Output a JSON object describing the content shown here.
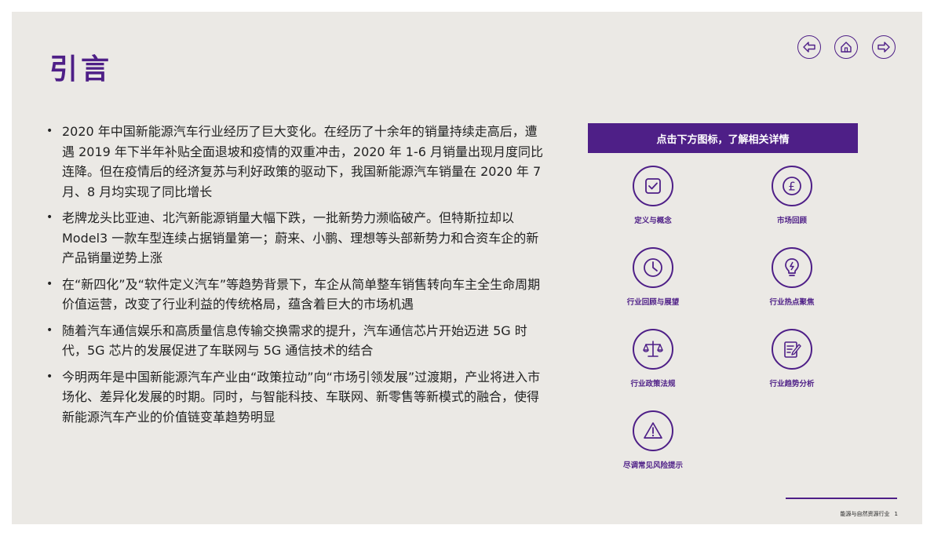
{
  "title": "引言",
  "nav": [
    {
      "name": "back-button",
      "icon": "arrow-left-icon"
    },
    {
      "name": "home-button",
      "icon": "home-icon"
    },
    {
      "name": "forward-button",
      "icon": "arrow-right-icon"
    }
  ],
  "bullets": [
    "2020 年中国新能源汽车行业经历了巨大变化。在经历了十余年的销量持续走高后，遭遇 2019 年下半年补贴全面退坡和疫情的双重冲击，2020 年 1-6 月销量出现月度同比连降。但在疫情后的经济复苏与利好政策的驱动下，我国新能源汽车销量在 2020 年 7 月、8 月均实现了同比增长",
    "老牌龙头比亚迪、北汽新能源销量大幅下跌，一批新势力濒临破产。但特斯拉却以 Model3 一款车型连续占据销量第一；蔚来、小鹏、理想等头部新势力和合资车企的新产品销量逆势上涨",
    "在“新四化”及“软件定义汽车”等趋势背景下，车企从简单整车销售转向车主全生命周期价值运营，改变了行业利益的传统格局，蕴含着巨大的市场机遇",
    "随着汽车通信娱乐和高质量信息传输交换需求的提升，汽车通信芯片开始迈进 5G 时代，5G 芯片的发展促进了车联网与 5G 通信技术的结合",
    "今明两年是中国新能源汽车产业由“政策拉动”向“市场引领发展”过渡期，产业将进入市场化、差异化发展的时期。同时，与智能科技、车联网、新零售等新模式的融合，使得新能源汽车产业的价值链变革趋势明显"
  ],
  "panel": {
    "header": "点击下方图标，了解相关详情",
    "tiles": [
      {
        "label": "定义与概念",
        "icon": "checkbox-icon"
      },
      {
        "label": "市场回顾",
        "icon": "pound-icon"
      },
      {
        "label": "行业回顾与展望",
        "icon": "clock-icon"
      },
      {
        "label": "行业热点聚焦",
        "icon": "lightbulb-icon"
      },
      {
        "label": "行业政策法规",
        "icon": "scales-icon"
      },
      {
        "label": "行业趋势分析",
        "icon": "document-edit-icon"
      },
      {
        "label": "尽调常见风险提示",
        "icon": "warning-icon"
      }
    ]
  },
  "footer": {
    "text": "能源与自然资源行业",
    "page": "1"
  },
  "colors": {
    "accent": "#4e1f87",
    "background": "#ebe9e5"
  }
}
